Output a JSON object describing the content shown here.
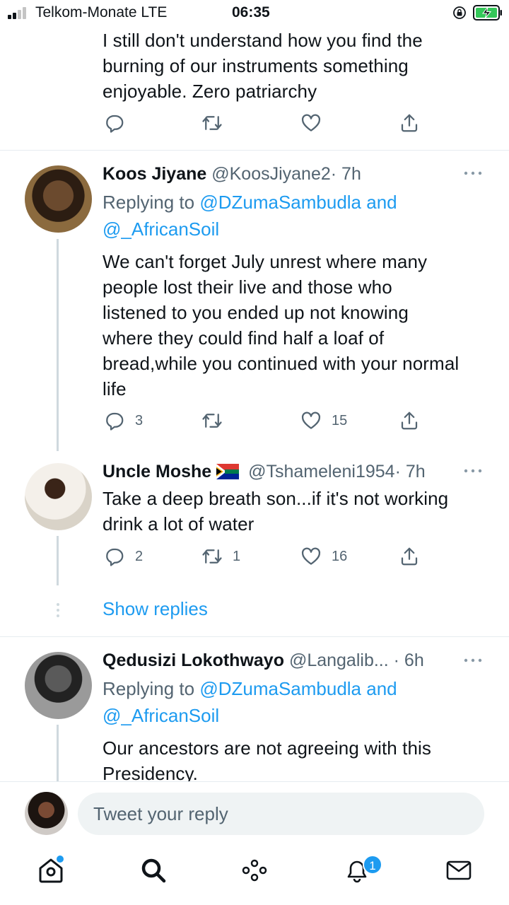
{
  "status_bar": {
    "carrier": "Telkom-Monate  LTE",
    "time": "06:35"
  },
  "top_tweet": {
    "text_lines": [
      "I still don't understand how you find the",
      "burning of our instruments something",
      "enjoyable. Zero patriarchy"
    ]
  },
  "tweets": [
    {
      "name": "Koos Jiyane",
      "handle": "@KoosJiyane2",
      "time": "· 7h",
      "replying_label": "Replying to",
      "replying_mentions_1": "@DZumaSambudla and",
      "replying_mentions_2": "@_AfricanSoil",
      "text_lines": [
        "We can't forget July unrest where many",
        "people lost their live and those who",
        "listened to you ended up not knowing",
        "where they could find half a loaf of",
        "bread,while you continued with your normal",
        "life"
      ],
      "replies": "3",
      "retweets": "",
      "likes": "15"
    },
    {
      "name": "Uncle Moshe",
      "handle": "@Tshameleni1954",
      "time": "· 7h",
      "text_lines": [
        "Take a deep breath son...if it's not working",
        "drink a lot of water"
      ],
      "replies": "2",
      "retweets": "1",
      "likes": "16"
    },
    {
      "name": "Qedusizi Lokothwayo",
      "handle": "@Langalib...",
      "time": "· 6h",
      "replying_label": "Replying to",
      "replying_mentions_1": "@DZumaSambudla and",
      "replying_mentions_2": "@_AfricanSoil",
      "text_lines": [
        "Our ancestors are not agreeing with this",
        "Presidency."
      ]
    }
  ],
  "show_replies": "Show replies",
  "composer": {
    "placeholder": "Tweet your reply"
  },
  "bottom_nav": {
    "items": [
      "home-icon",
      "search-icon",
      "spaces-icon",
      "notifications-icon",
      "messages-icon"
    ],
    "notifications_badge": "1"
  },
  "colors": {
    "accent": "#1d9bf0",
    "text": "#0f1419",
    "muted": "#536471",
    "thread_line": "#cfd9de"
  }
}
